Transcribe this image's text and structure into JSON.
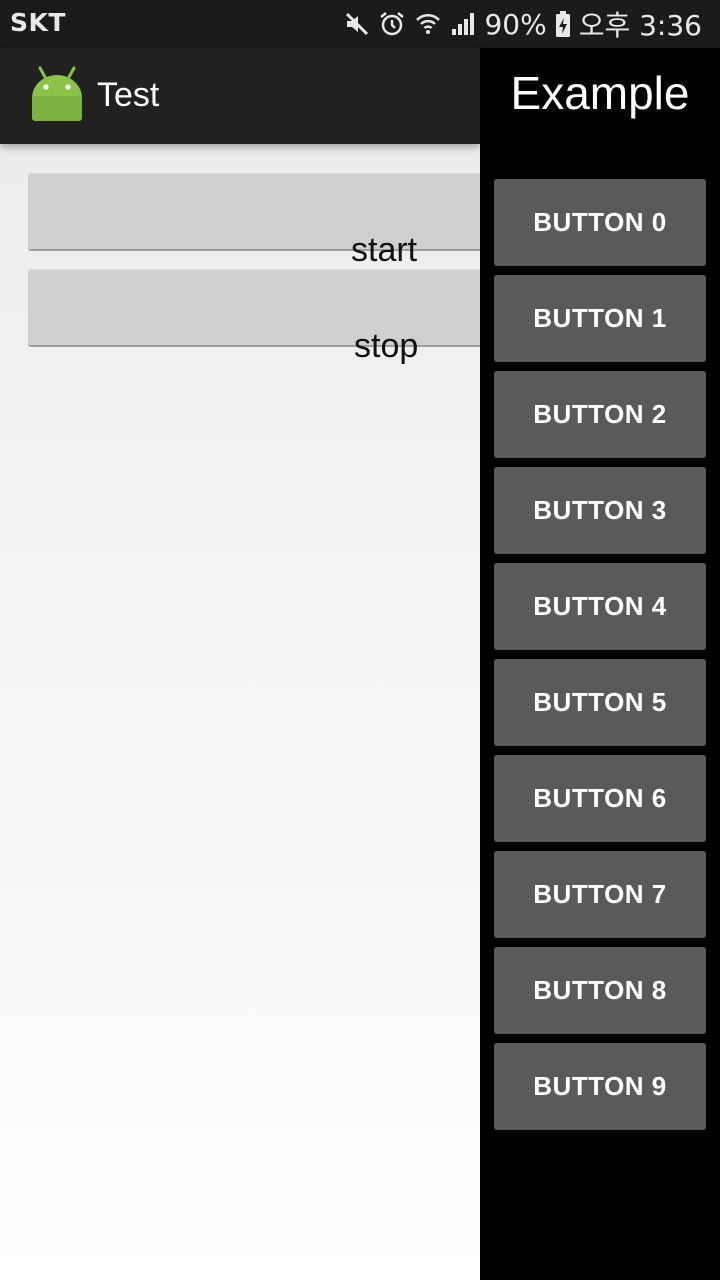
{
  "status_bar": {
    "carrier": "SKT",
    "battery_percent": "90%",
    "time": "오후 3:36",
    "icons": [
      "mute-icon",
      "alarm-icon",
      "wifi-icon",
      "signal-icon",
      "battery-charging-icon"
    ]
  },
  "action_bar": {
    "title": "Test",
    "icon": "android-icon"
  },
  "main": {
    "start_label": "start",
    "stop_label": "stop"
  },
  "drawer": {
    "title": "Example",
    "buttons": [
      "BUTTON 0",
      "BUTTON 1",
      "BUTTON 2",
      "BUTTON 3",
      "BUTTON 4",
      "BUTTON 5",
      "BUTTON 6",
      "BUTTON 7",
      "BUTTON 8",
      "BUTTON 9"
    ]
  },
  "colors": {
    "status_bar_bg": "#1b1b1b",
    "action_bar_bg": "#212121",
    "drawer_bg": "#000000",
    "drawer_button_bg": "#5a5a5c",
    "main_button_bg": "#d0d0d0",
    "android_green": "#8bc34a"
  }
}
